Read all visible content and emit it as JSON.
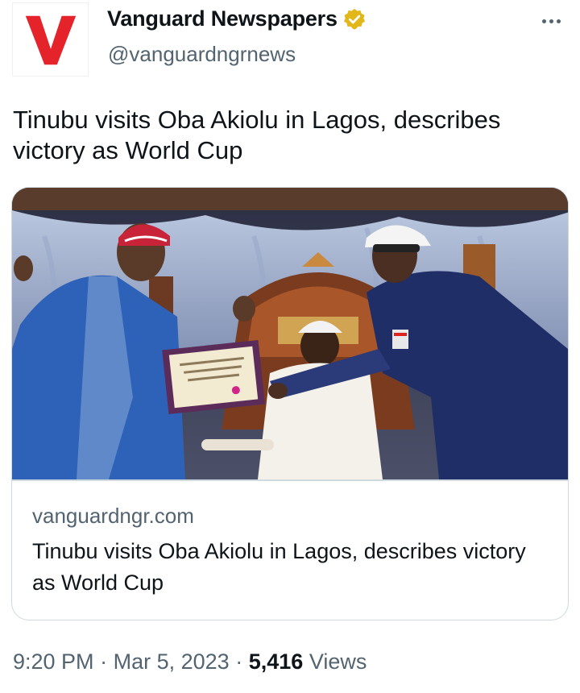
{
  "author": {
    "display_name": "Vanguard Newspapers",
    "handle": "@vanguardngrnews",
    "avatar_letter": "V",
    "verified": true,
    "verified_color": "#e2b719",
    "brand_color": "#e5232b"
  },
  "tweet": {
    "text": "Tinubu visits Oba Akiolu in Lagos, describes victory as World Cup"
  },
  "card": {
    "domain": "vanguardngr.com",
    "title": "Tinubu visits Oba Akiolu in Lagos, describes victory as World Cup"
  },
  "meta": {
    "time": "9:20 PM",
    "separator_1": "·",
    "date": "Mar 5, 2023",
    "separator_2": "·",
    "views_count": "5,416",
    "views_label": "Views"
  },
  "icons": {
    "more": "more-options-icon",
    "verified": "verified-badge-icon"
  }
}
